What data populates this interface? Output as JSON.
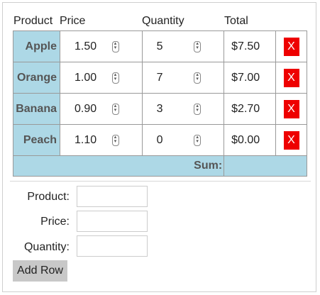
{
  "headers": {
    "product": "Product",
    "price": "Price",
    "quantity": "Quantity",
    "total": "Total"
  },
  "rows": [
    {
      "product": "Apple",
      "price": "1.50",
      "quantity": "5",
      "total": "$7.50",
      "delete": "X"
    },
    {
      "product": "Orange",
      "price": "1.00",
      "quantity": "7",
      "total": "$7.00",
      "delete": "X"
    },
    {
      "product": "Banana",
      "price": "0.90",
      "quantity": "3",
      "total": "$2.70",
      "delete": "X"
    },
    {
      "product": "Peach",
      "price": "1.10",
      "quantity": "0",
      "total": "$0.00",
      "delete": "X"
    }
  ],
  "sum": {
    "label": "Sum:",
    "value": ""
  },
  "form": {
    "product_label": "Product:",
    "product_value": "",
    "price_label": "Price:",
    "price_value": "",
    "quantity_label": "Quantity:",
    "quantity_value": "",
    "add_label": "Add Row"
  },
  "colors": {
    "row_header_bg": "#add8e6",
    "delete_bg": "#ee0000",
    "add_bg": "#c8c8c8"
  },
  "icons": {
    "spinner": "updown-spinner-icon"
  }
}
